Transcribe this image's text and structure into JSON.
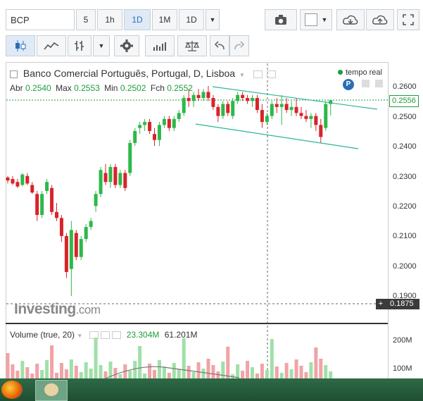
{
  "toolbar": {
    "symbol": "BCP",
    "intervals": [
      "5",
      "1h",
      "1D",
      "1M",
      "1D"
    ],
    "selected_interval": "1D"
  },
  "chart_title": "Banco Comercial Português, Portugal, D, Lisboa",
  "realtime_label": "tempo real",
  "ohlc": {
    "open_label": "Abr",
    "open": "0.2540",
    "max_label": "Max",
    "max": "0.2553",
    "min_label": "Min",
    "min": "0.2502",
    "close_label": "Fch",
    "close": "0.2552"
  },
  "price_axis": [
    "0.2600",
    "0.2500",
    "0.2400",
    "0.2300",
    "0.2200",
    "0.2100",
    "0.2000",
    "0.1900"
  ],
  "current_price": "0.2556",
  "crosshair_price": "0.1875",
  "watermark": {
    "brand": "Investing",
    "suffix": ".com"
  },
  "volume": {
    "title": "Volume (true, 20)",
    "value1": "23.304M",
    "value2": "61.201M",
    "axis": [
      "200M",
      "100M"
    ]
  },
  "colors": {
    "up": "#2db84a",
    "down": "#d8232a",
    "accent": "#2b6fb5",
    "channel": "#29b59a"
  },
  "chart_data": {
    "type": "candlestick",
    "ylim": [
      0.1875,
      0.2625
    ],
    "candles": [
      [
        0.2295,
        0.23,
        0.2275,
        0.2285
      ],
      [
        0.229,
        0.23,
        0.227,
        0.2275
      ],
      [
        0.228,
        0.229,
        0.226,
        0.2265
      ],
      [
        0.227,
        0.231,
        0.2265,
        0.2305
      ],
      [
        0.23,
        0.231,
        0.227,
        0.2275
      ],
      [
        0.227,
        0.228,
        0.224,
        0.2245
      ],
      [
        0.224,
        0.225,
        0.215,
        0.217
      ],
      [
        0.217,
        0.225,
        0.216,
        0.224
      ],
      [
        0.225,
        0.229,
        0.224,
        0.228
      ],
      [
        0.226,
        0.227,
        0.217,
        0.218
      ],
      [
        0.218,
        0.221,
        0.215,
        0.216
      ],
      [
        0.216,
        0.217,
        0.208,
        0.21
      ],
      [
        0.21,
        0.211,
        0.196,
        0.198
      ],
      [
        0.199,
        0.215,
        0.19,
        0.212
      ],
      [
        0.211,
        0.212,
        0.202,
        0.203
      ],
      [
        0.203,
        0.21,
        0.202,
        0.209
      ],
      [
        0.209,
        0.214,
        0.208,
        0.213
      ],
      [
        0.213,
        0.216,
        0.212,
        0.215
      ],
      [
        0.22,
        0.225,
        0.218,
        0.224
      ],
      [
        0.224,
        0.233,
        0.223,
        0.232
      ],
      [
        0.231,
        0.234,
        0.227,
        0.228
      ],
      [
        0.228,
        0.234,
        0.226,
        0.233
      ],
      [
        0.233,
        0.234,
        0.226,
        0.227
      ],
      [
        0.227,
        0.232,
        0.226,
        0.231
      ],
      [
        0.231,
        0.232,
        0.225,
        0.226
      ],
      [
        0.231,
        0.242,
        0.23,
        0.241
      ],
      [
        0.241,
        0.246,
        0.24,
        0.245
      ],
      [
        0.246,
        0.248,
        0.244,
        0.247
      ],
      [
        0.247,
        0.249,
        0.245,
        0.248
      ],
      [
        0.248,
        0.249,
        0.244,
        0.245
      ],
      [
        0.244,
        0.246,
        0.24,
        0.242
      ],
      [
        0.242,
        0.248,
        0.24,
        0.247
      ],
      [
        0.247,
        0.25,
        0.246,
        0.249
      ],
      [
        0.249,
        0.25,
        0.245,
        0.246
      ],
      [
        0.246,
        0.25,
        0.245,
        0.249
      ],
      [
        0.249,
        0.252,
        0.248,
        0.251
      ],
      [
        0.251,
        0.257,
        0.25,
        0.256
      ],
      [
        0.256,
        0.259,
        0.253,
        0.255
      ],
      [
        0.255,
        0.258,
        0.253,
        0.257
      ],
      [
        0.257,
        0.259,
        0.255,
        0.256
      ],
      [
        0.256,
        0.259,
        0.255,
        0.258
      ],
      [
        0.258,
        0.26,
        0.255,
        0.256
      ],
      [
        0.256,
        0.257,
        0.252,
        0.253
      ],
      [
        0.253,
        0.254,
        0.248,
        0.25
      ],
      [
        0.25,
        0.255,
        0.249,
        0.254
      ],
      [
        0.254,
        0.255,
        0.25,
        0.251
      ],
      [
        0.25,
        0.256,
        0.249,
        0.255
      ],
      [
        0.255,
        0.258,
        0.254,
        0.257
      ],
      [
        0.257,
        0.258,
        0.255,
        0.256
      ],
      [
        0.256,
        0.257,
        0.254,
        0.255
      ],
      [
        0.255,
        0.257,
        0.253,
        0.256
      ],
      [
        0.256,
        0.257,
        0.251,
        0.252
      ],
      [
        0.252,
        0.254,
        0.246,
        0.248
      ],
      [
        0.248,
        0.251,
        0.247,
        0.25
      ],
      [
        0.25,
        0.255,
        0.249,
        0.254
      ],
      [
        0.254,
        0.256,
        0.251,
        0.253
      ],
      [
        0.253,
        0.257,
        0.247,
        0.254
      ],
      [
        0.254,
        0.256,
        0.251,
        0.252
      ],
      [
        0.252,
        0.255,
        0.25,
        0.253
      ],
      [
        0.253,
        0.256,
        0.25,
        0.251
      ],
      [
        0.251,
        0.253,
        0.249,
        0.25
      ],
      [
        0.25,
        0.252,
        0.248,
        0.249
      ],
      [
        0.249,
        0.251,
        0.246,
        0.25
      ],
      [
        0.25,
        0.251,
        0.245,
        0.247
      ],
      [
        0.247,
        0.249,
        0.241,
        0.243
      ],
      [
        0.246,
        0.255,
        0.245,
        0.254
      ],
      [
        0.254,
        0.2553,
        0.2502,
        0.2552
      ]
    ],
    "volume_axis_max": 260
  }
}
